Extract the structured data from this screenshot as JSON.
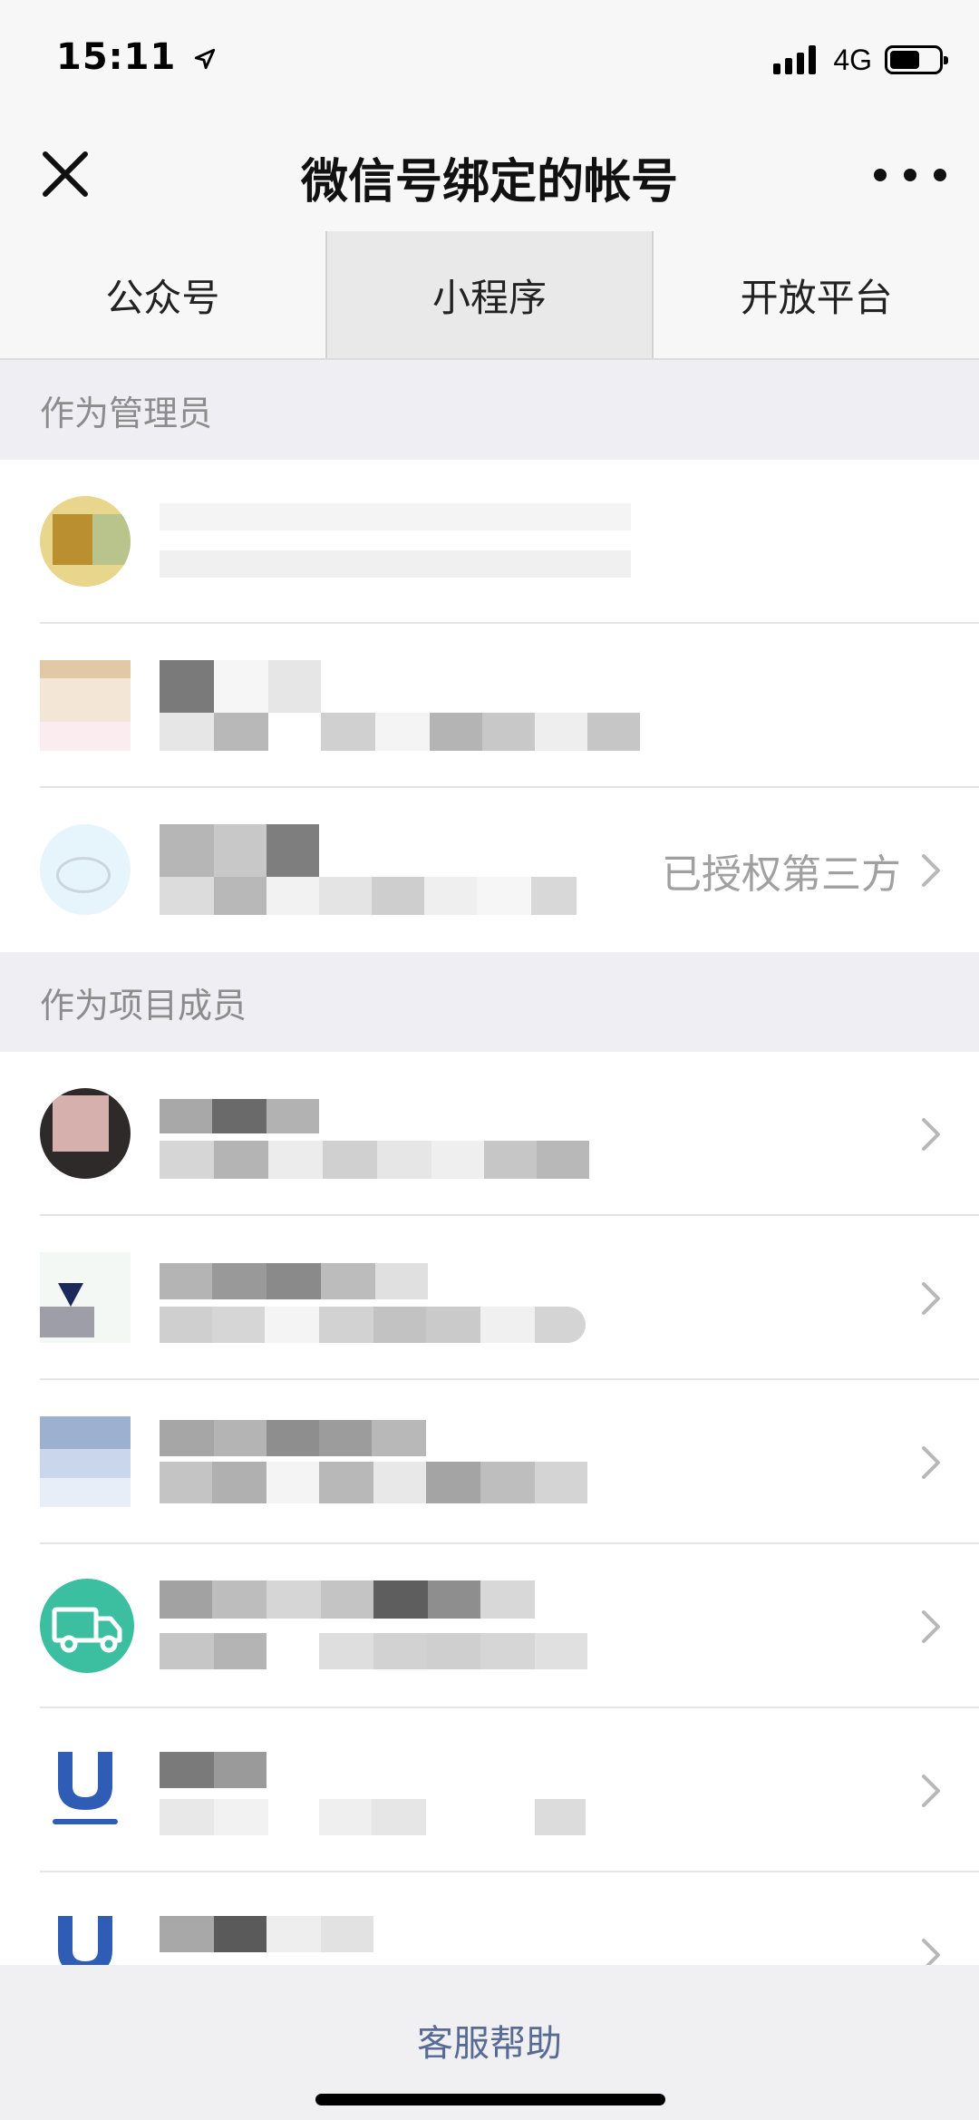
{
  "status_bar": {
    "time": "15:11",
    "network": "4G",
    "icons": [
      "location-arrow-icon",
      "signal-icon",
      "battery-icon"
    ]
  },
  "nav": {
    "title": "微信号绑定的帐号",
    "close_icon": "close-icon",
    "more_icon": "more-icon"
  },
  "tabs": [
    {
      "label": "公众号",
      "active": false
    },
    {
      "label": "小程序",
      "active": true
    },
    {
      "label": "开放平台",
      "active": false
    }
  ],
  "sections": [
    {
      "title": "作为管理员",
      "items": [
        {
          "meta": "",
          "has_chevron": false
        },
        {
          "meta": "",
          "has_chevron": false
        },
        {
          "meta": "已授权第三方",
          "has_chevron": true
        }
      ]
    },
    {
      "title": "作为项目成员",
      "items": [
        {
          "meta": "",
          "has_chevron": true
        },
        {
          "meta": "",
          "has_chevron": true
        },
        {
          "meta": "",
          "has_chevron": true
        },
        {
          "meta": "",
          "has_chevron": true
        },
        {
          "meta": "",
          "has_chevron": true
        },
        {
          "meta": "",
          "has_chevron": true
        }
      ]
    }
  ],
  "footer": {
    "help_label": "客服帮助"
  },
  "colors": {
    "link": "#576b95",
    "background": "#f7f7f7",
    "section_header": "#eeeef3"
  }
}
